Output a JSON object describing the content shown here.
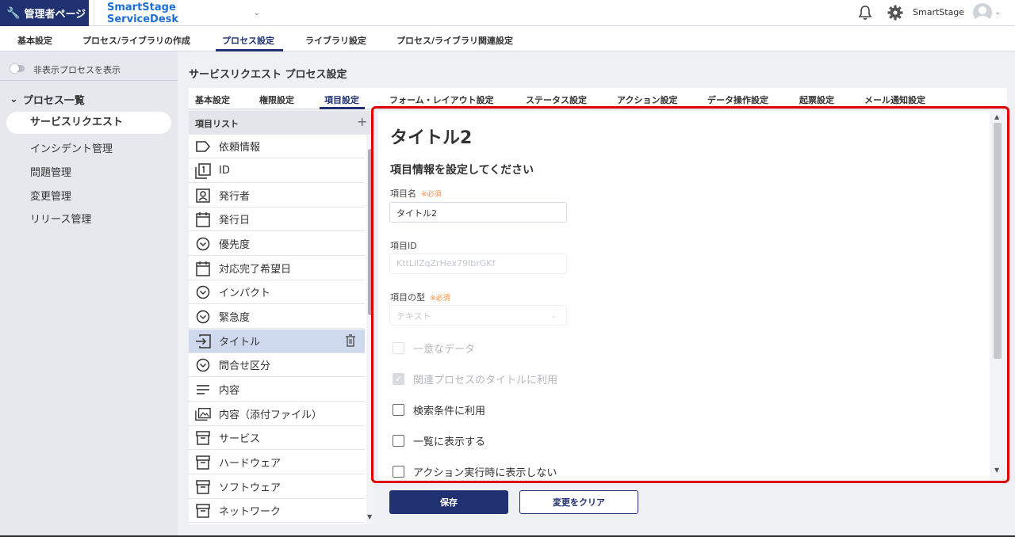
{
  "header": {
    "admin_label": "管理者ページ",
    "app_title": "SmartStage ServiceDesk",
    "user_name": "SmartStage"
  },
  "main_nav": [
    {
      "label": "基本設定"
    },
    {
      "label": "プロセス/ライブラリの作成"
    },
    {
      "label": "プロセス設定",
      "active": true
    },
    {
      "label": "ライブラリ設定"
    },
    {
      "label": "プロセス/ライブラリ関連設定"
    }
  ],
  "sidebar": {
    "toggle_label": "非表示プロセスを表示",
    "section_title": "プロセス一覧",
    "items": [
      {
        "label": "サービスリクエスト",
        "active": true
      },
      {
        "label": "インシデント管理"
      },
      {
        "label": "問題管理"
      },
      {
        "label": "変更管理"
      },
      {
        "label": "リリース管理"
      }
    ]
  },
  "page_title": "サービスリクエスト プロセス設定",
  "sub_tabs": [
    {
      "label": "基本設定"
    },
    {
      "label": "権限設定"
    },
    {
      "label": "項目設定",
      "active": true
    },
    {
      "label": "フォーム・レイアウト設定"
    },
    {
      "label": "ステータス設定"
    },
    {
      "label": "アクション設定"
    },
    {
      "label": "データ操作設定"
    },
    {
      "label": "起票設定"
    },
    {
      "label": "メール通知設定"
    }
  ],
  "item_list": {
    "header": "項目リスト",
    "items": [
      {
        "label": "依頼情報",
        "icon": "label-icon"
      },
      {
        "label": "ID",
        "icon": "id-icon"
      },
      {
        "label": "発行者",
        "icon": "person-icon"
      },
      {
        "label": "発行日",
        "icon": "calendar-icon"
      },
      {
        "label": "優先度",
        "icon": "dropdown-circle-icon"
      },
      {
        "label": "対応完了希望日",
        "icon": "calendar-icon"
      },
      {
        "label": "インパクト",
        "icon": "dropdown-circle-icon"
      },
      {
        "label": "緊急度",
        "icon": "dropdown-circle-icon"
      },
      {
        "label": "タイトル",
        "icon": "text-input-icon",
        "selected": true
      },
      {
        "label": "問合せ区分",
        "icon": "dropdown-circle-icon"
      },
      {
        "label": "内容",
        "icon": "lines-icon"
      },
      {
        "label": "内容（添付ファイル）",
        "icon": "image-icon"
      },
      {
        "label": "サービス",
        "icon": "archive-icon"
      },
      {
        "label": "ハードウェア",
        "icon": "archive-icon"
      },
      {
        "label": "ソフトウェア",
        "icon": "archive-icon"
      },
      {
        "label": "ネットワーク",
        "icon": "archive-icon"
      }
    ]
  },
  "form": {
    "title": "タイトル2",
    "subtitle": "項目情報を設定してください",
    "required_mark": "※必須",
    "name_label": "項目名",
    "name_value": "タイトル2",
    "id_label": "項目ID",
    "id_value": "KttLilZqZrHex79IbrGKf",
    "type_label": "項目の型",
    "type_value": "テキスト",
    "checkboxes": [
      {
        "label": "一意なデータ",
        "checked": false,
        "disabled": true
      },
      {
        "label": "関連プロセスのタイトルに利用",
        "checked": true,
        "disabled": true
      },
      {
        "label": "検索条件に利用",
        "checked": false,
        "disabled": false
      },
      {
        "label": "一覧に表示する",
        "checked": false,
        "disabled": false
      },
      {
        "label": "アクション実行時に表示しない",
        "checked": false,
        "disabled": false
      }
    ]
  },
  "buttons": {
    "save": "保存",
    "clear": "変更をクリア"
  },
  "colors": {
    "brand": "#1f3171",
    "link": "#1d6fd1",
    "required": "#ff8a3d",
    "highlight_frame": "#e00000",
    "selected_row": "#cfd9ee"
  }
}
